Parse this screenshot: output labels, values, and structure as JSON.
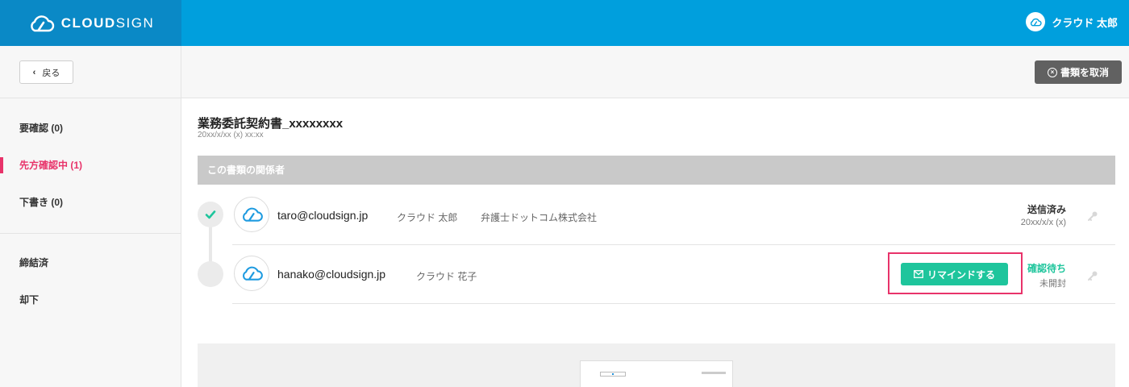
{
  "header": {
    "brand_bold": "CLOUD",
    "brand_light": "SIGN",
    "user_name": "クラウド 太郎"
  },
  "toolbar": {
    "back_label": "戻る",
    "cancel_label": "書類を取消"
  },
  "sidebar": {
    "items": [
      {
        "label": "要確認 (0)",
        "active": false
      },
      {
        "label": "先方確認中 (1)",
        "active": true
      },
      {
        "label": "下書き (0)",
        "active": false
      },
      {
        "label": "締結済",
        "active": false
      },
      {
        "label": "却下",
        "active": false
      }
    ]
  },
  "document": {
    "title": "業務委託契約書_xxxxxxxx",
    "date": "20xx/x/xx (x) xx:xx",
    "section_title": "この書類の関係者"
  },
  "parties": [
    {
      "email": "taro@cloudsign.jp",
      "name": "クラウド 太郎",
      "company": "弁護士ドットコム株式会社",
      "status": "送信済み",
      "status_sub": "20xx/x/x (x)",
      "done": true
    },
    {
      "email": "hanako@cloudsign.jp",
      "name": "クラウド 花子",
      "company": "",
      "status": "確認待ち",
      "status_sub": "未開封",
      "done": false
    }
  ],
  "remind": {
    "label": "リマインドする"
  },
  "colors": {
    "header": "#009fdd",
    "brand": "#0a89c6",
    "active": "#e8336a",
    "green": "#1ec59c",
    "cancel": "#616161"
  },
  "icons": [
    "cloudsign-logo-icon",
    "chevron-left-icon",
    "circle-x-icon",
    "check-icon",
    "key-icon",
    "mail-icon"
  ]
}
